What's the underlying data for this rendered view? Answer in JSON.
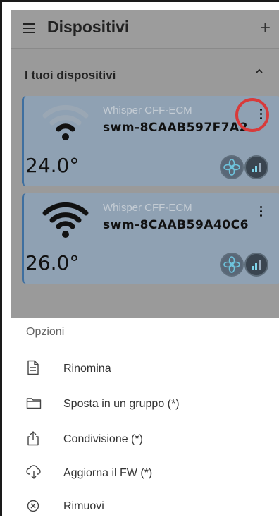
{
  "header": {
    "title": "Dispositivi",
    "menu_icon": "hamburger-menu-icon",
    "add_icon": "plus-icon"
  },
  "section": {
    "title": "I tuoi dispositivi",
    "collapse_icon": "chevron-up-icon"
  },
  "devices": [
    {
      "model": "Whisper CFF-ECM",
      "serial": "swm-8CAAB597F7A2",
      "temperature": "24.0°",
      "wifi_strength": 3,
      "highlighted_menu": true
    },
    {
      "model": "Whisper CFF-ECM",
      "serial": "swm-8CAAB59A40C6",
      "temperature": "26.0°",
      "wifi_strength": 4,
      "highlighted_menu": false
    }
  ],
  "options_sheet": {
    "title": "Opzioni",
    "items": [
      {
        "label": "Rinomina",
        "icon": "document-icon"
      },
      {
        "label": "Sposta in un gruppo (*)",
        "icon": "folder-icon"
      },
      {
        "label": "Condivisione (*)",
        "icon": "share-icon"
      },
      {
        "label": "Aggiorna il FW (*)",
        "icon": "cloud-download-icon"
      },
      {
        "label": "Rimuovi",
        "icon": "remove-circle-icon"
      }
    ]
  },
  "colors": {
    "highlight": "#d83b3b",
    "card": "#8fa1b3",
    "accent_bar": "#3e6fa0"
  }
}
